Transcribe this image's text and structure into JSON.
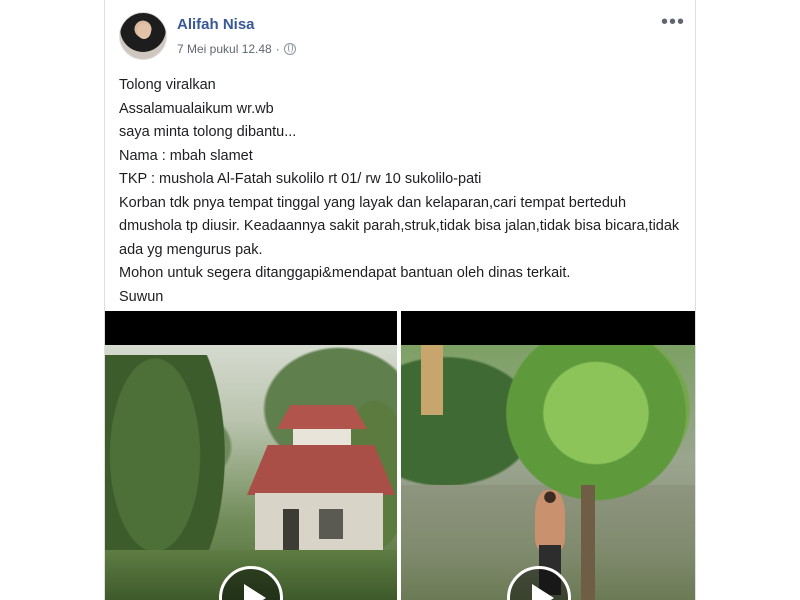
{
  "post": {
    "author": "Alifah Nisa",
    "timestamp": "7 Mei pukul 12.48",
    "meta_separator": "·",
    "more_icon_label": "•••",
    "privacy_icon": "globe-icon",
    "body_lines": [
      "Tolong viralkan",
      "Assalamualaikum wr.wb",
      "saya minta tolong dibantu...",
      "Nama : mbah slamet",
      "TKP : mushola Al-Fatah sukolilo rt 01/ rw 10 sukolilo-pati",
      "Korban tdk pnya tempat tinggal yang layak dan kelaparan,cari tempat berteduh dmushola tp diusir. Keadaannya sakit parah,struk,tidak bisa jalan,tidak bisa bicara,tidak ada yg mengurus pak.",
      "Mohon untuk segera ditanggapi&mendapat bantuan oleh dinas terkait.",
      "Suwun"
    ],
    "videos": [
      {
        "icon": "play-icon"
      },
      {
        "icon": "play-icon"
      }
    ]
  },
  "colors": {
    "author_link": "#385898",
    "meta_text": "#616770",
    "body_text": "#1c1e21",
    "border": "#dddfe2"
  }
}
